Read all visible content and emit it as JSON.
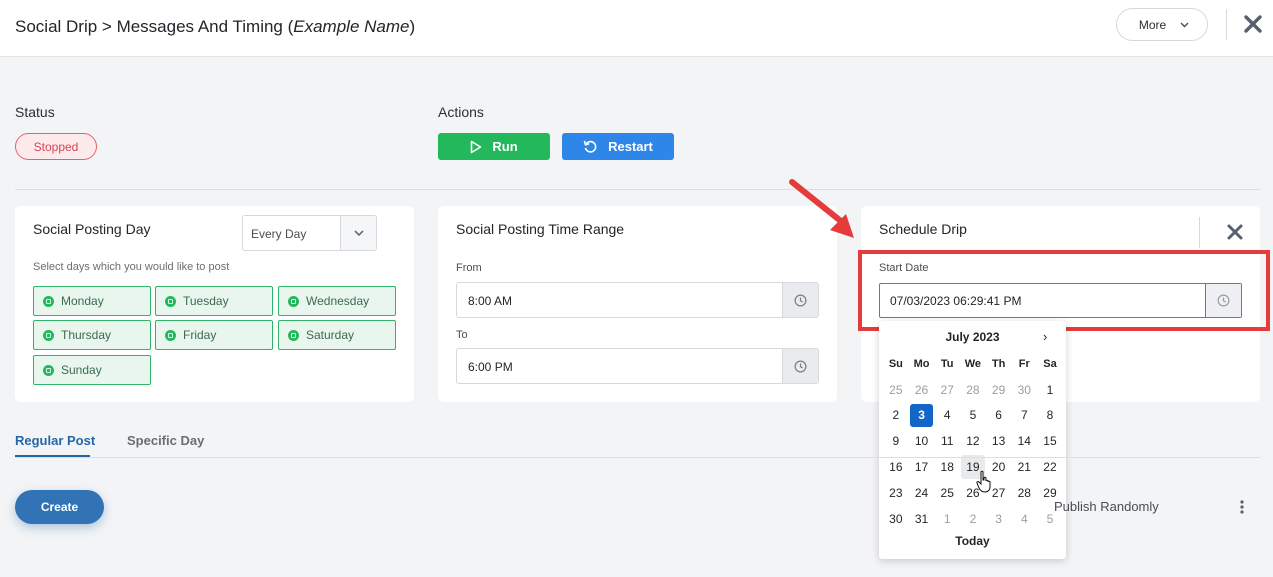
{
  "header": {
    "title_prefix": "Social Drip > Messages And Timing (",
    "title_name": "Example Name",
    "title_suffix": ")",
    "more_label": "More"
  },
  "status": {
    "label": "Status",
    "badge": "Stopped"
  },
  "actions": {
    "label": "Actions",
    "run_label": "Run",
    "restart_label": "Restart"
  },
  "posting_day": {
    "title": "Social Posting Day",
    "select_value": "Every Day",
    "hint": "Select days which you would like to post",
    "days": [
      "Monday",
      "Tuesday",
      "Wednesday",
      "Thursday",
      "Friday",
      "Saturday",
      "Sunday"
    ]
  },
  "time_range": {
    "title": "Social Posting Time Range",
    "from_label": "From",
    "from_value": "8:00 AM",
    "to_label": "To",
    "to_value": "6:00 PM"
  },
  "schedule": {
    "title": "Schedule Drip",
    "start_label": "Start Date",
    "start_value": "07/03/2023 06:29:41 PM"
  },
  "calendar": {
    "month": "July 2023",
    "weekdays": [
      "Su",
      "Mo",
      "Tu",
      "We",
      "Th",
      "Fr",
      "Sa"
    ],
    "weeks": [
      [
        "25",
        "26",
        "27",
        "28",
        "29",
        "30",
        "1"
      ],
      [
        "2",
        "3",
        "4",
        "5",
        "6",
        "7",
        "8"
      ],
      [
        "9",
        "10",
        "11",
        "12",
        "13",
        "14",
        "15"
      ],
      [
        "16",
        "17",
        "18",
        "19",
        "20",
        "21",
        "22"
      ],
      [
        "23",
        "24",
        "25",
        "26",
        "27",
        "28",
        "29"
      ],
      [
        "30",
        "31",
        "1",
        "2",
        "3",
        "4",
        "5"
      ]
    ],
    "selected": "3",
    "hovered": "19",
    "today_label": "Today"
  },
  "tabs": {
    "regular": "Regular Post",
    "specific": "Specific Day"
  },
  "create_label": "Create",
  "publish_label": "Publish Randomly",
  "colors": {
    "run": "#22b85b",
    "restart": "#2d86e8",
    "highlight": "#e53b3b",
    "selected_day": "#1366c9"
  }
}
